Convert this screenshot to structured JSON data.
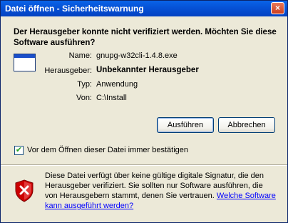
{
  "window": {
    "title": "Datei öffnen - Sicherheitswarnung",
    "close_glyph": "×"
  },
  "question": "Der Herausgeber konnte nicht verifiziert werden. Möchten Sie diese Software ausführen?",
  "file": {
    "name_label": "Name:",
    "name_value": "gnupg-w32cli-1.4.8.exe",
    "publisher_label": "Herausgeber:",
    "publisher_value": "Unbekannter Herausgeber",
    "type_label": "Typ:",
    "type_value": "Anwendung",
    "from_label": "Von:",
    "from_value": "C:\\Install"
  },
  "buttons": {
    "run": "Ausführen",
    "cancel": "Abbrechen"
  },
  "checkbox": {
    "label": "Vor dem Öffnen dieser Datei immer bestätigen",
    "checked": true,
    "mark": "✔"
  },
  "warning": {
    "text": "Diese Datei verfügt über keine gültige digitale Signatur, die den Herausgeber verifiziert. Sie sollten nur Software ausführen, die von Herausgebern stammt, denen Sie vertrauen. ",
    "link": "Welche Software kann ausgeführt werden?"
  },
  "colors": {
    "titlebar": "#0653d8",
    "dialog_bg": "#ece9d8",
    "link": "#0000ff",
    "shield": "#cc0000"
  }
}
